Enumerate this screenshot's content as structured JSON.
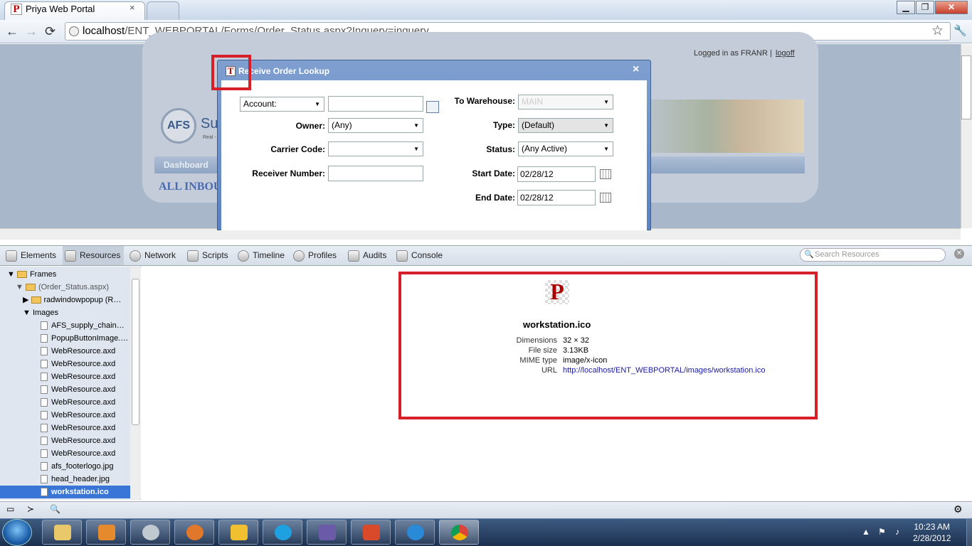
{
  "browser": {
    "tab_title": "Priya Web Portal",
    "tab_close": "×",
    "url_host": "localhost",
    "url_path": "/ENT_WEBPORTAL/Forms/Order_Status.aspx?Inquery=inquery",
    "win_min": "▁",
    "win_max": "❐",
    "win_close": "✕",
    "back": "←",
    "forward": "→",
    "reload": "⟳",
    "star": "☆",
    "wrench": "🔧"
  },
  "page": {
    "logged_in_as": "Logged in as FRANR |",
    "logoff": "logoff",
    "logo_circle": "AFS",
    "logo_text": "Su",
    "logo_sub": "Real -",
    "nav_dashboard": "Dashboard",
    "all_inbound": "ALL INBOU"
  },
  "dialog": {
    "title": "Receive Order Lookup",
    "close": "×",
    "account_select": "Account:",
    "owner_label": "Owner:",
    "owner_value": "(Any)",
    "carrier_label": "Carrier Code:",
    "carrier_value": "",
    "receiver_label": "Receiver Number:",
    "warehouse_label": "To Warehouse:",
    "warehouse_value": "MAIN",
    "type_label": "Type:",
    "type_value": "(Default)",
    "status_label": "Status:",
    "status_value": "(Any Active)",
    "start_label": "Start Date:",
    "start_value": "02/28/12",
    "end_label": "End Date:",
    "end_value": "02/28/12"
  },
  "devtools": {
    "tabs": [
      "Elements",
      "Resources",
      "Network",
      "Scripts",
      "Timeline",
      "Profiles",
      "Audits",
      "Console"
    ],
    "search_placeholder": "Search Resources",
    "tree": {
      "frames": "Frames",
      "order_status": "(Order_Status.aspx)",
      "radwindow": "radwindowpopup (R…",
      "images": "Images",
      "files": [
        "AFS_supply_chain…",
        "PopupButtonImage.…",
        "WebResource.axd",
        "WebResource.axd",
        "WebResource.axd",
        "WebResource.axd",
        "WebResource.axd",
        "WebResource.axd",
        "WebResource.axd",
        "WebResource.axd",
        "WebResource.axd",
        "afs_footerlogo.jpg",
        "head_header.jpg",
        "workstation.ico"
      ]
    },
    "resource": {
      "name": "workstation.ico",
      "dimensions_label": "Dimensions",
      "dimensions": "32 × 32",
      "filesize_label": "File size",
      "filesize": "3.13KB",
      "mime_label": "MIME type",
      "mime": "image/x-icon",
      "url_label": "URL",
      "url": "http://localhost/ENT_WEBPORTAL/images/workstation.ico"
    }
  },
  "taskbar": {
    "time": "10:23 AM",
    "date": "2/28/2012",
    "tray_up": "▲"
  }
}
